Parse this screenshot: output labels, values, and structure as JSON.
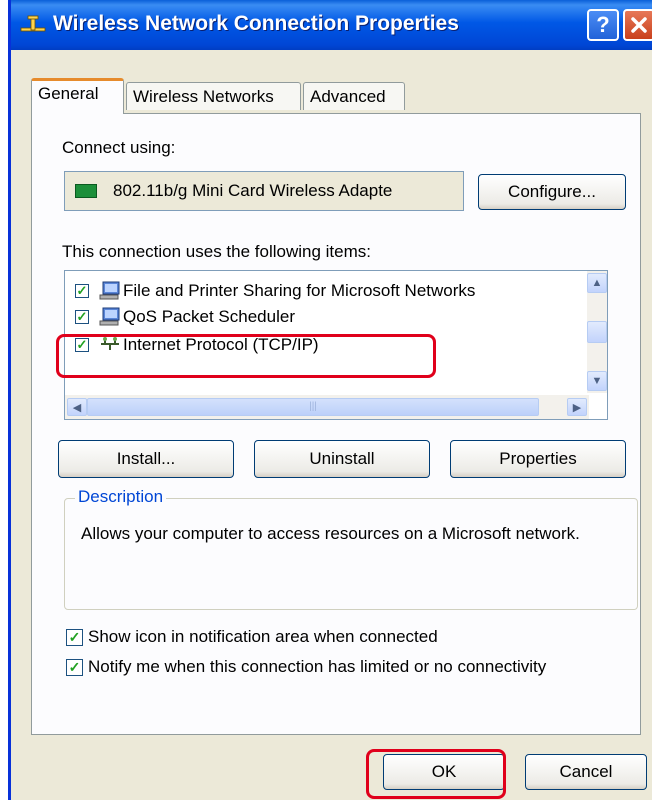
{
  "window": {
    "title": "Wireless Network Connection Properties",
    "help_label": "?"
  },
  "tabs": [
    {
      "label": "General",
      "active": true
    },
    {
      "label": "Wireless Networks",
      "active": false
    },
    {
      "label": "Advanced",
      "active": false
    }
  ],
  "connect_using": {
    "label": "Connect using:",
    "adapter": "802.11b/g Mini Card Wireless Adapte",
    "configure_label": "Configure..."
  },
  "items_section": {
    "label": "This connection uses the following items:",
    "items": [
      {
        "label": "File and Printer Sharing for Microsoft Networks",
        "checked": true,
        "icon": "network-service-icon"
      },
      {
        "label": "QoS Packet Scheduler",
        "checked": true,
        "icon": "network-service-icon"
      },
      {
        "label": "Internet Protocol (TCP/IP)",
        "checked": true,
        "icon": "protocol-icon"
      }
    ]
  },
  "buttons": {
    "install": "Install...",
    "uninstall": "Uninstall",
    "properties": "Properties",
    "ok": "OK",
    "cancel": "Cancel"
  },
  "description": {
    "title": "Description",
    "text": "Allows your computer to access resources on a Microsoft network."
  },
  "options": [
    {
      "label": "Show icon in notification area when connected",
      "checked": true
    },
    {
      "label": "Notify me when this connection has limited or no connectivity",
      "checked": true
    }
  ],
  "colors": {
    "titlebar": "#0058e6",
    "highlight": "#e0001b",
    "dialog_bg": "#ece9d8"
  }
}
